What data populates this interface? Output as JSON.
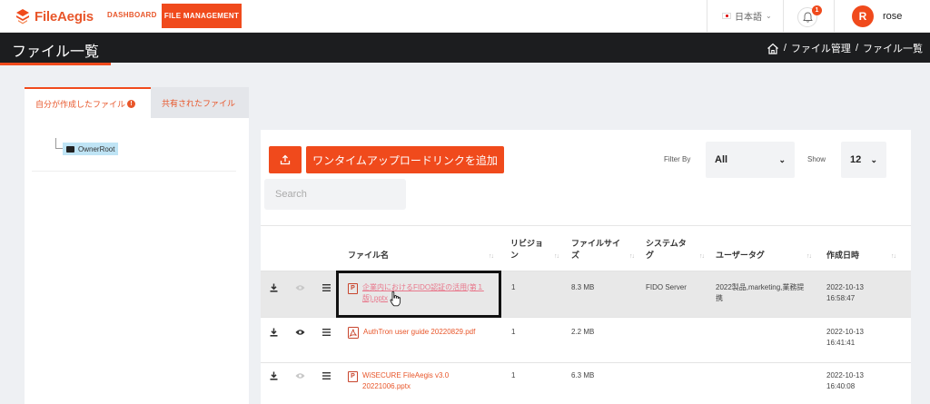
{
  "app": {
    "brand": "FileAegis",
    "nav": {
      "dashboard": "DASHBOARD",
      "file_management": "FILE MANAGEMENT"
    },
    "language": "日本語",
    "notification_count": "1",
    "user": {
      "initial": "R",
      "name": "rose"
    }
  },
  "page": {
    "title": "ファイル一覧",
    "breadcrumb": [
      "ファイル管理",
      "ファイル一覧"
    ]
  },
  "tabs": [
    {
      "label": "自分が作成したファイル",
      "badge": "!"
    },
    {
      "label": "共有されたファイル"
    }
  ],
  "tree": {
    "root": "OwnerRoot"
  },
  "toolbar": {
    "add_onetime_link": "ワンタイムアップロードリンクを追加",
    "filter_label": "Filter By",
    "filter_value": "All",
    "show_label": "Show",
    "show_value": "12",
    "search_placeholder": "Search"
  },
  "table": {
    "headers": {
      "filename": "ファイル名",
      "revision_1": "リビジョ",
      "revision_2": "ン",
      "filesize_1": "ファイルサイ",
      "filesize_2": "ズ",
      "systag_1": "システムタ",
      "systag_2": "グ",
      "usertag": "ユーザータグ",
      "created": "作成日時"
    },
    "rows": [
      {
        "icon": "P",
        "name_1": "企業内におけるFIDO認証の活用(第１",
        "name_2": "版).pptx",
        "revision": "1",
        "size": "8.3 MB",
        "system_tag": "FIDO Server",
        "user_tag_1": "2022製品,marketing,業務提",
        "user_tag_2": "携",
        "date": "2022-10-13",
        "time": "16:58:47"
      },
      {
        "icon": "pdf",
        "name_1": "AuthTron user guide 20220829.pdf",
        "name_2": "",
        "revision": "1",
        "size": "2.2 MB",
        "system_tag": "",
        "user_tag_1": "",
        "user_tag_2": "",
        "date": "2022-10-13",
        "time": "16:41:41"
      },
      {
        "icon": "P",
        "name_1": "WiSECURE FileAegis v3.0",
        "name_2": "20221006.pptx",
        "revision": "1",
        "size": "6.3 MB",
        "system_tag": "",
        "user_tag_1": "",
        "user_tag_2": "",
        "date": "2022-10-13",
        "time": "16:40:08"
      }
    ]
  }
}
